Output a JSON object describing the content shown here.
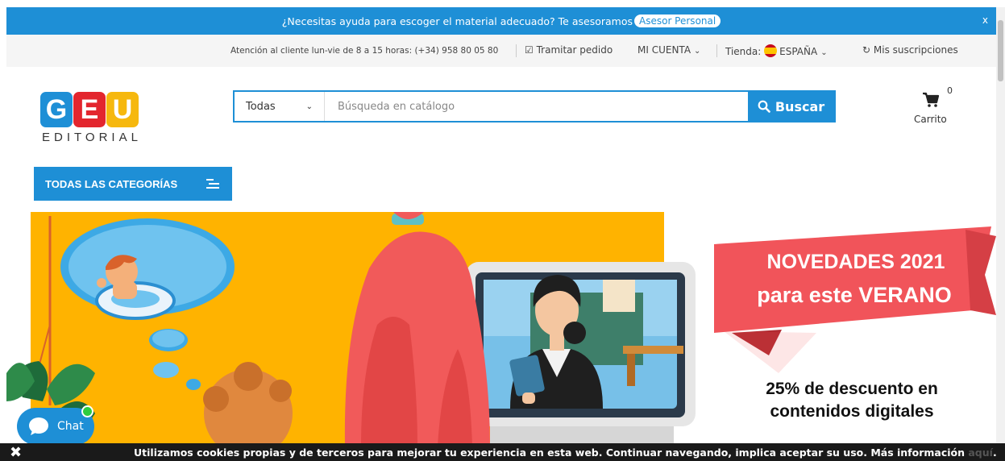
{
  "promo": {
    "text": "¿Necesitas ayuda para escoger el material adecuado? Te asesoramos",
    "button": "Asesor Personal",
    "close": "x"
  },
  "utility": {
    "support": "Atención al cliente lun-vie de 8 a 15 horas: (+34) 958 80 05 80",
    "order": "Tramitar pedido",
    "account": "MI CUENTA",
    "store_label": "Tienda:",
    "store_value": "ESPAÑA",
    "subscriptions": "Mis suscripciones"
  },
  "logo": {
    "letters": [
      "G",
      "E",
      "U"
    ],
    "colors": [
      "#1e8fd6",
      "#e3262e",
      "#f6b80e"
    ],
    "subtitle": "EDITORIAL"
  },
  "search": {
    "category": "Todas",
    "placeholder": "Búsqueda en catálogo",
    "button": "Buscar"
  },
  "cart": {
    "count": "0",
    "label": "Carrito"
  },
  "categories_button": "TODAS LAS CATEGORÍAS",
  "banner": {
    "headline_1": "NOVEDADES 2021",
    "headline_2": "para este VERANO",
    "discount_1": "25% de descuento en",
    "discount_2": "contenidos digitales",
    "colors": {
      "yellow": "#ffb300",
      "ribbon": "#f1545a",
      "hair": "#f15a5a"
    }
  },
  "chat": {
    "label": "Chat"
  },
  "cookie": {
    "text": "Utilizamos cookies propias y de terceros para mejorar tu experiencia en esta web. Continuar navegando, implica aceptar su uso. Más información",
    "link": "aquí",
    "tail": "."
  }
}
